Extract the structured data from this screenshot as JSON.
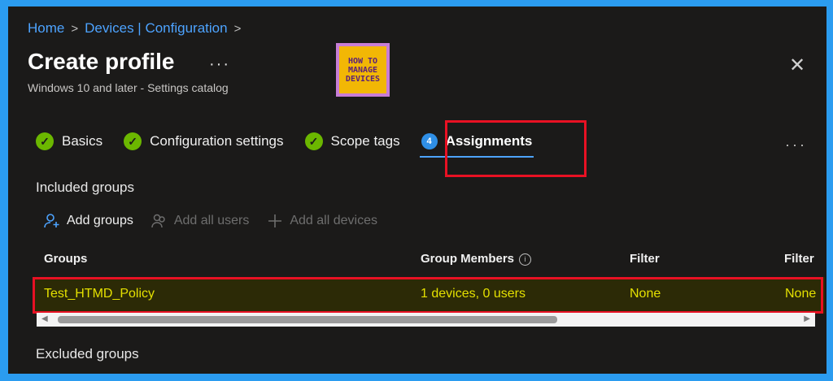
{
  "breadcrumb": {
    "home": "Home",
    "devices": "Devices | Configuration"
  },
  "page": {
    "title": "Create profile",
    "subtitle": "Windows 10 and later - Settings catalog",
    "more": "···"
  },
  "logo": {
    "line1": "HOW TO",
    "line2": "MANAGE",
    "line3": "DEVICES"
  },
  "tabs": [
    {
      "label": "Basics",
      "state": "complete"
    },
    {
      "label": "Configuration settings",
      "state": "complete"
    },
    {
      "label": "Scope tags",
      "state": "complete"
    },
    {
      "label": "Assignments",
      "state": "active",
      "step": "4"
    }
  ],
  "tabs_more": "···",
  "included": {
    "title": "Included groups",
    "actions": {
      "add_groups": "Add groups",
      "add_all_users": "Add all users",
      "add_all_devices": "Add all devices"
    },
    "columns": {
      "groups": "Groups",
      "members": "Group Members",
      "filter": "Filter",
      "filter_mode": "Filter"
    },
    "rows": [
      {
        "group": "Test_HTMD_Policy",
        "members": "1 devices, 0 users",
        "filter": "None",
        "filter_mode": "None"
      }
    ]
  },
  "excluded": {
    "title": "Excluded groups"
  },
  "colors": {
    "accent": "#4da3ff",
    "highlight": "#e81123",
    "success": "#6bb700",
    "row_text": "#e4e000"
  }
}
